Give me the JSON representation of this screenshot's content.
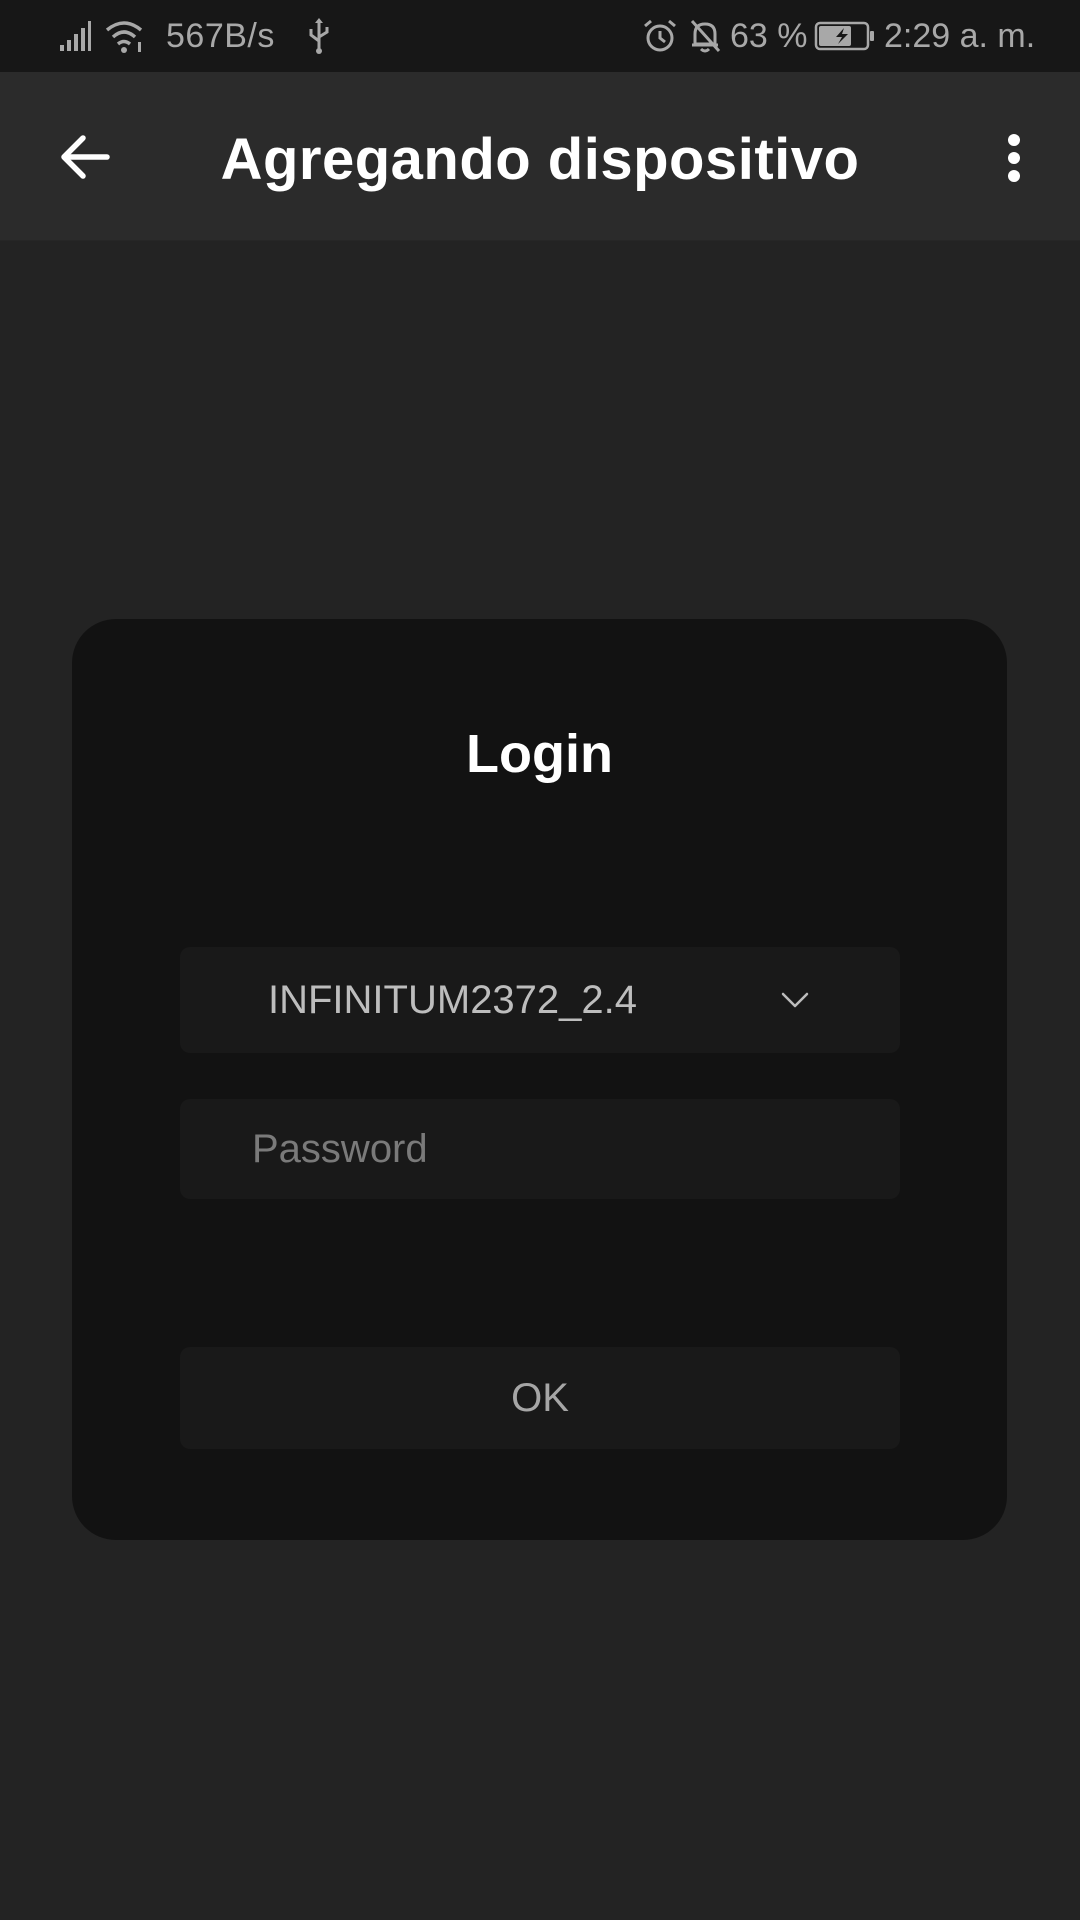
{
  "status_bar": {
    "net_speed": "567B/s",
    "battery_percent": "63 %",
    "time": "2:29 a. m.",
    "icons": [
      "signal-icon",
      "wifi-icon",
      "usb-icon",
      "alarm-icon",
      "notifications-off-icon",
      "battery-charging-icon"
    ]
  },
  "app_bar": {
    "title": "Agregando dispositivo",
    "back_icon": "arrow-left-icon",
    "menu_icon": "more-vertical-icon"
  },
  "dialog": {
    "title": "Login",
    "network": {
      "selected": "INFINITUM2372_2.4",
      "icon": "chevron-down-icon"
    },
    "password": {
      "value": "",
      "placeholder": "Password"
    },
    "ok_label": "OK"
  },
  "colors": {
    "background": "#232323",
    "status_bar": "#171717",
    "app_bar": "#2b2b2b",
    "dialog": "#121212",
    "field": "#191919",
    "title_text": "#ffffff"
  }
}
